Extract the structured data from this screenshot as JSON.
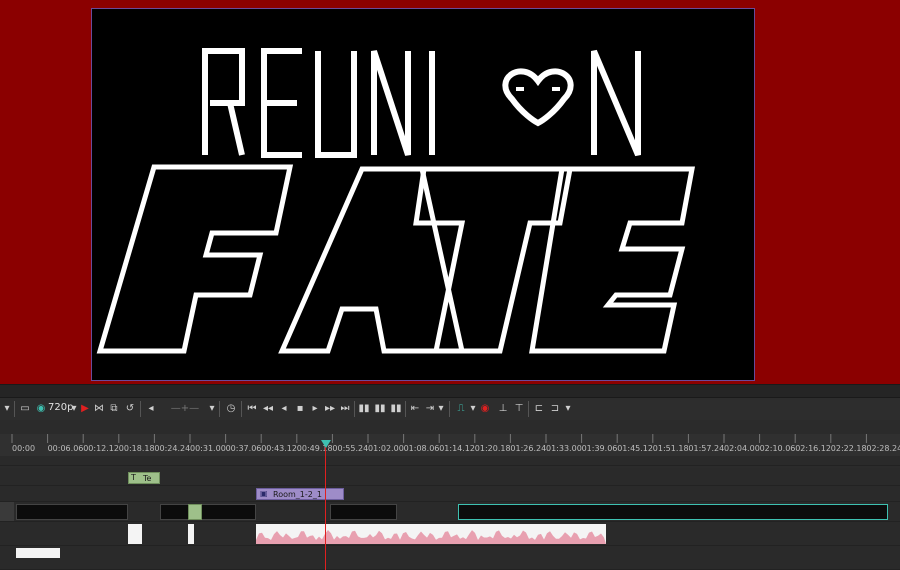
{
  "toolbar": {
    "resolution": "720p",
    "icons": [
      "monitor-icon",
      "eye-icon",
      "record-icon",
      "trim-icon",
      "loop-icon",
      "volume-icon",
      "clock-icon",
      "skip-start-icon",
      "prev-frame-icon",
      "step-back-icon",
      "stop-icon",
      "step-forward-icon",
      "next-frame-icon",
      "skip-end-icon",
      "marker-icon",
      "snap-icon",
      "zoom-icon"
    ]
  },
  "ruler": {
    "ticks": [
      "00:00",
      "00:06.06",
      "00:12.12",
      "00:18.18",
      "00:24.24",
      "00:31.00",
      "00:37.06",
      "00:43.12",
      "00:49.18",
      "00:55.24",
      "01:02.00",
      "01:08.06",
      "01:14.12",
      "01:20.18",
      "01:26.24",
      "01:33.00",
      "01:39.06",
      "01:45.12",
      "01:51.18",
      "01:57.24",
      "02:04.00",
      "02:10.06",
      "02:16.12",
      "02:22.18",
      "02:28.24"
    ]
  },
  "clips": {
    "text_clip_label": "Te",
    "room_clip_label": "Room_1-2_1"
  },
  "colors": {
    "background": "#8b0000",
    "accent": "#3ec1b1",
    "playhead": "#e02020",
    "audio": "#e8a0b0",
    "text_clip": "#9ec08a",
    "room_clip": "#9e8cc8"
  }
}
